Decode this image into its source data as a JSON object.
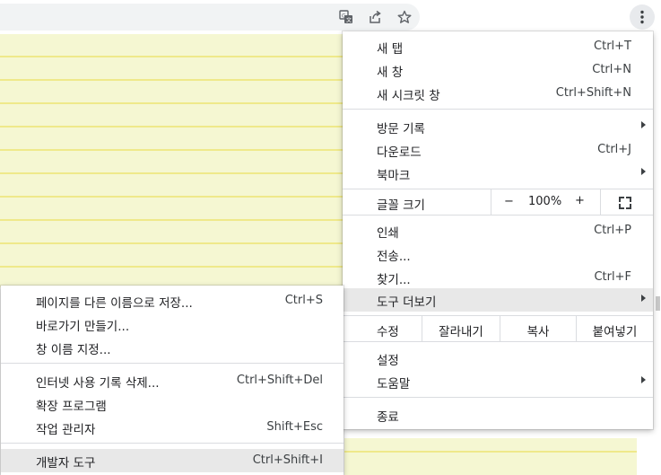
{
  "colors": {
    "paper": "#f5f7d2",
    "paper_rule": "#efe98a",
    "highlight": "#e8e8e8",
    "menu_bg": "#ffffff"
  },
  "toolbar": {
    "icons": [
      "translate-icon",
      "share-icon",
      "bookmark-star-icon",
      "more-menu-icon"
    ]
  },
  "main_menu": {
    "new_tab": {
      "label": "새 탭",
      "shortcut": "Ctrl+T"
    },
    "new_window": {
      "label": "새 창",
      "shortcut": "Ctrl+N"
    },
    "new_incognito": {
      "label": "새 시크릿 창",
      "shortcut": "Ctrl+Shift+N"
    },
    "history": {
      "label": "방문 기록"
    },
    "downloads": {
      "label": "다운로드",
      "shortcut": "Ctrl+J"
    },
    "bookmarks": {
      "label": "북마크"
    },
    "zoom": {
      "label": "글꼴 크기",
      "minus": "−",
      "value": "100%",
      "plus": "+"
    },
    "print": {
      "label": "인쇄",
      "shortcut": "Ctrl+P"
    },
    "cast": {
      "label": "전송..."
    },
    "find": {
      "label": "찾기...",
      "shortcut": "Ctrl+F"
    },
    "more_tools": {
      "label": "도구 더보기"
    },
    "edit": {
      "label": "수정",
      "cut": "잘라내기",
      "copy": "복사",
      "paste": "붙여넣기"
    },
    "settings": {
      "label": "설정"
    },
    "help": {
      "label": "도움말"
    },
    "exit": {
      "label": "종료"
    }
  },
  "sub_menu": {
    "save_page": {
      "label": "페이지를 다른 이름으로 저장...",
      "shortcut": "Ctrl+S"
    },
    "create_shortcut": {
      "label": "바로가기 만들기..."
    },
    "name_window": {
      "label": "창 이름 지정..."
    },
    "clear_data": {
      "label": "인터넷 사용 기록 삭제...",
      "shortcut": "Ctrl+Shift+Del"
    },
    "extensions": {
      "label": "확장 프로그램"
    },
    "task_manager": {
      "label": "작업 관리자",
      "shortcut": "Shift+Esc"
    },
    "dev_tools": {
      "label": "개발자 도구",
      "shortcut": "Ctrl+Shift+I"
    }
  }
}
